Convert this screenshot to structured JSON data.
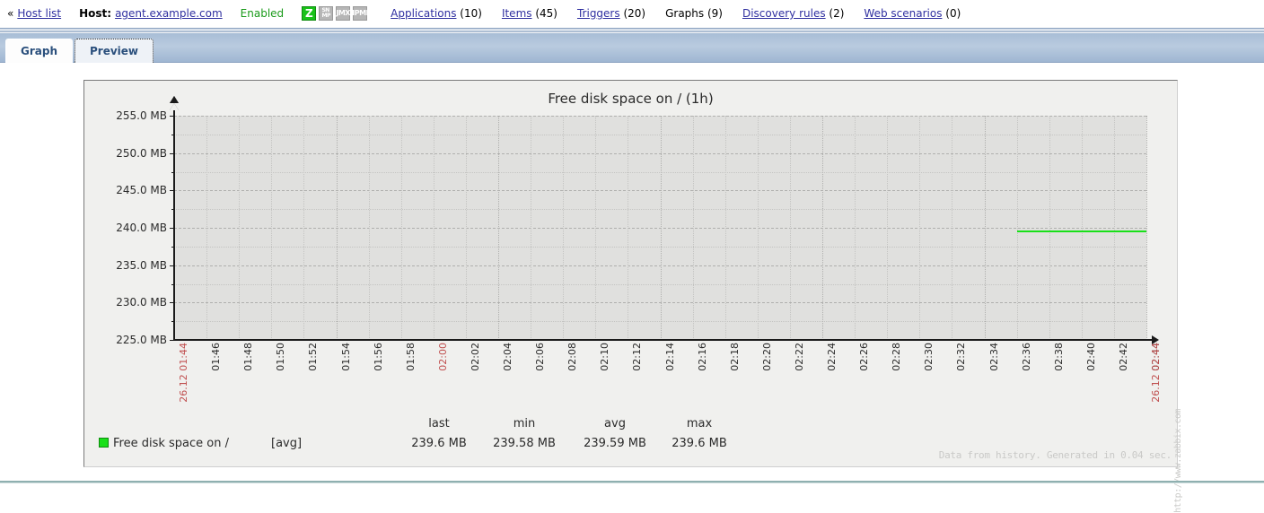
{
  "header": {
    "back_chevron": "«",
    "host_list_link": "Host list",
    "host_label": "Host:",
    "host_name": "agent.example.com",
    "status": "Enabled",
    "availability_icons": [
      {
        "name": "zabbix-agent-icon",
        "glyph": "Z",
        "state": "on"
      },
      {
        "name": "snmp-icon",
        "line1": "SN",
        "line2": "MP",
        "state": "off"
      },
      {
        "name": "jmx-icon",
        "glyph": "JMX",
        "state": "off"
      },
      {
        "name": "ipmi-icon",
        "glyph": "IPMI",
        "state": "off"
      }
    ],
    "nav": [
      {
        "label": "Applications",
        "count": "(10)",
        "current": false
      },
      {
        "label": "Items",
        "count": "(45)",
        "current": false
      },
      {
        "label": "Triggers",
        "count": "(20)",
        "current": false
      },
      {
        "label": "Graphs",
        "count": "(9)",
        "current": true
      },
      {
        "label": "Discovery rules",
        "count": "(2)",
        "current": false
      },
      {
        "label": "Web scenarios",
        "count": "(0)",
        "current": false
      }
    ]
  },
  "tabs": [
    {
      "label": "Graph",
      "active": true
    },
    {
      "label": "Preview",
      "active": false
    }
  ],
  "graph": {
    "title": "Free disk space on / (1h)",
    "watermark": "http://www.zabbix.com",
    "footer": "Data from history. Generated in 0.04 sec.",
    "legend": {
      "headers": [
        "last",
        "min",
        "avg",
        "max"
      ],
      "item_name": "Free disk space on /",
      "function": "[avg]",
      "color": "#19e019",
      "values": [
        "239.6 MB",
        "239.58 MB",
        "239.59 MB",
        "239.6 MB"
      ]
    }
  },
  "chart_data": {
    "type": "line",
    "title": "Free disk space on / (1h)",
    "xlabel": "",
    "ylabel": "",
    "ylim": [
      225.0,
      255.0
    ],
    "ytick_labels": [
      "255.0 MB",
      "250.0 MB",
      "245.0 MB",
      "240.0 MB",
      "235.0 MB",
      "230.0 MB",
      "225.0 MB"
    ],
    "ytick_values": [
      255.0,
      250.0,
      245.0,
      240.0,
      235.0,
      230.0,
      225.0
    ],
    "yunit": "MB",
    "grid": true,
    "legend_position": "bottom",
    "x_start_label": "26.12 01:44",
    "x_end_label": "26.12 02:44",
    "xtick_labels": [
      "26.12 01:44",
      "01:46",
      "01:48",
      "01:50",
      "01:52",
      "01:54",
      "01:56",
      "01:58",
      "02:00",
      "02:02",
      "02:04",
      "02:06",
      "02:08",
      "02:10",
      "02:12",
      "02:14",
      "02:16",
      "02:18",
      "02:20",
      "02:22",
      "02:24",
      "02:26",
      "02:28",
      "02:30",
      "02:32",
      "02:34",
      "02:36",
      "02:38",
      "02:40",
      "02:42",
      "02:44",
      "26.12 02:44"
    ],
    "highlighted_xticks": [
      "26.12 01:44",
      "02:00",
      "26.12 02:44"
    ],
    "series": [
      {
        "name": "Free disk space on /",
        "color": "#19e019",
        "function": "avg",
        "x": [
          "02:36",
          "02:38",
          "02:40",
          "02:42",
          "02:44"
        ],
        "values": [
          239.6,
          239.6,
          239.6,
          239.6,
          239.6
        ],
        "last": 239.6,
        "min": 239.58,
        "avg": 239.59,
        "max": 239.6
      }
    ]
  }
}
